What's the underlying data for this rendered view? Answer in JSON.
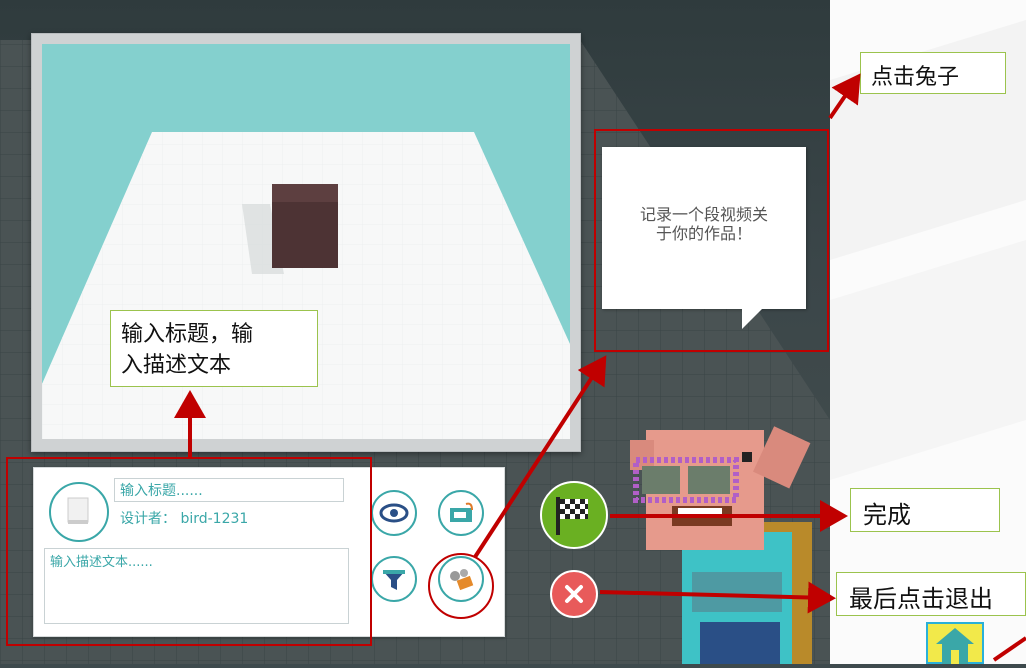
{
  "annotations": {
    "click_rabbit": "点击兔子",
    "enter_title_desc_line1": "输入标题，输",
    "enter_title_desc_line2": "入描述文本",
    "done": "完成",
    "finally_exit": "最后点击退出"
  },
  "speech_bubble": {
    "line1": "记录一个段视频关",
    "line2": "于你的作品！"
  },
  "form": {
    "title_placeholder": "输入标题......",
    "designer_label": "设计者：",
    "designer_name": "bird-1231",
    "desc_placeholder": "输入描述文本......"
  },
  "colors": {
    "accent": "#3aa7a8",
    "annotation_red": "#c00000",
    "annotation_border": "#9bc34d",
    "done_green": "#6ab022",
    "cancel_red": "#e85a5a",
    "home_yellow": "#f2e94a"
  },
  "icons": [
    "user-avatar-icon",
    "eye-icon",
    "share-screen-icon",
    "filter-icon",
    "video-record-icon",
    "checkered-flag-icon",
    "close-icon",
    "home-icon"
  ]
}
